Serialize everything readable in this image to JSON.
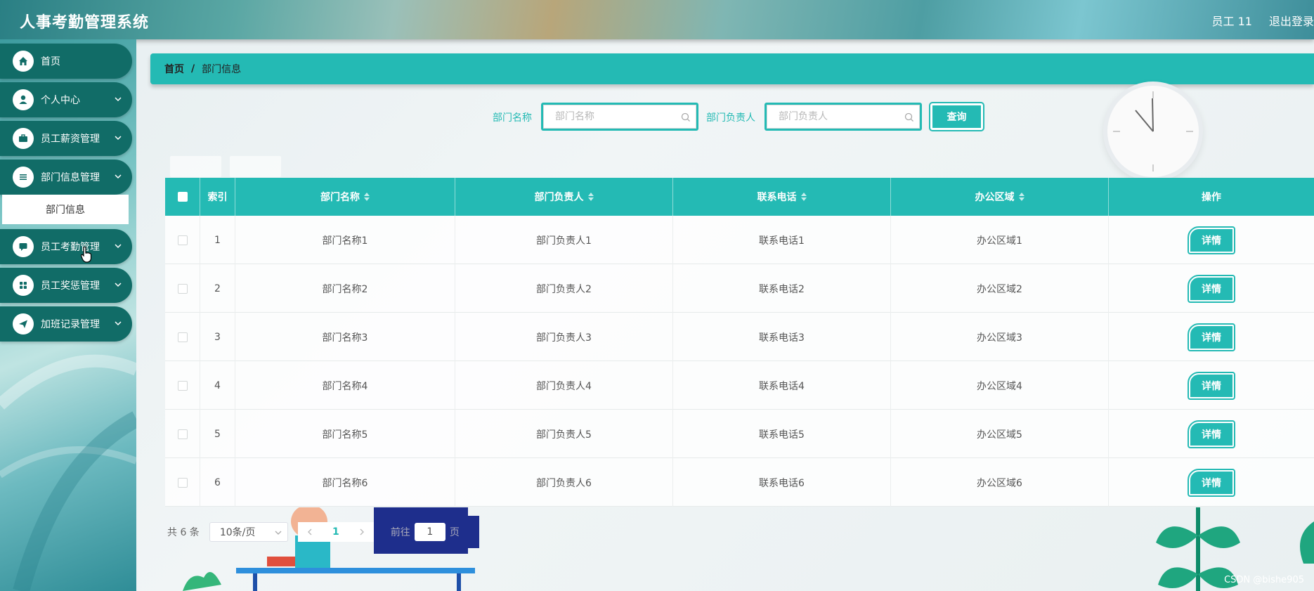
{
  "header": {
    "title": "人事考勤管理系统",
    "user": "员工 11",
    "logout": "退出登录"
  },
  "sidebar": {
    "items": [
      {
        "label": "首页",
        "icon": "home-icon"
      },
      {
        "label": "个人中心",
        "icon": "user-icon"
      },
      {
        "label": "员工薪资管理",
        "icon": "briefcase-icon"
      },
      {
        "label": "部门信息管理",
        "icon": "list-icon"
      },
      {
        "label": "员工考勤管理",
        "icon": "chat-icon"
      },
      {
        "label": "员工奖惩管理",
        "icon": "grid-icon"
      },
      {
        "label": "加班记录管理",
        "icon": "send-icon"
      }
    ],
    "submenu": {
      "label": "部门信息"
    }
  },
  "breadcrumb": {
    "home": "首页",
    "separator": "/",
    "current": "部门信息"
  },
  "search": {
    "dept_name_label": "部门名称",
    "dept_name_placeholder": "部门名称",
    "manager_label": "部门负责人",
    "manager_placeholder": "部门负责人",
    "query_label": "查询"
  },
  "table": {
    "headers": [
      "索引",
      "部门名称",
      "部门负责人",
      "联系电话",
      "办公区域",
      "操作"
    ],
    "rows": [
      {
        "index": "1",
        "name": "部门名称1",
        "manager": "部门负责人1",
        "phone": "联系电话1",
        "area": "办公区域1",
        "action": "详情"
      },
      {
        "index": "2",
        "name": "部门名称2",
        "manager": "部门负责人2",
        "phone": "联系电话2",
        "area": "办公区域2",
        "action": "详情"
      },
      {
        "index": "3",
        "name": "部门名称3",
        "manager": "部门负责人3",
        "phone": "联系电话3",
        "area": "办公区域3",
        "action": "详情"
      },
      {
        "index": "4",
        "name": "部门名称4",
        "manager": "部门负责人4",
        "phone": "联系电话4",
        "area": "办公区域4",
        "action": "详情"
      },
      {
        "index": "5",
        "name": "部门名称5",
        "manager": "部门负责人5",
        "phone": "联系电话5",
        "area": "办公区域5",
        "action": "详情"
      },
      {
        "index": "6",
        "name": "部门名称6",
        "manager": "部门负责人6",
        "phone": "联系电话6",
        "area": "办公区域6",
        "action": "详情"
      }
    ]
  },
  "pagination": {
    "total": "共 6 条",
    "page_size": "10条/页",
    "current": "1",
    "goto_prefix": "前往",
    "goto_value": "1",
    "goto_suffix": "页"
  },
  "watermark": "CSDN @bishe905",
  "colors": {
    "accent": "#24bab4",
    "menu": "#116c67"
  }
}
